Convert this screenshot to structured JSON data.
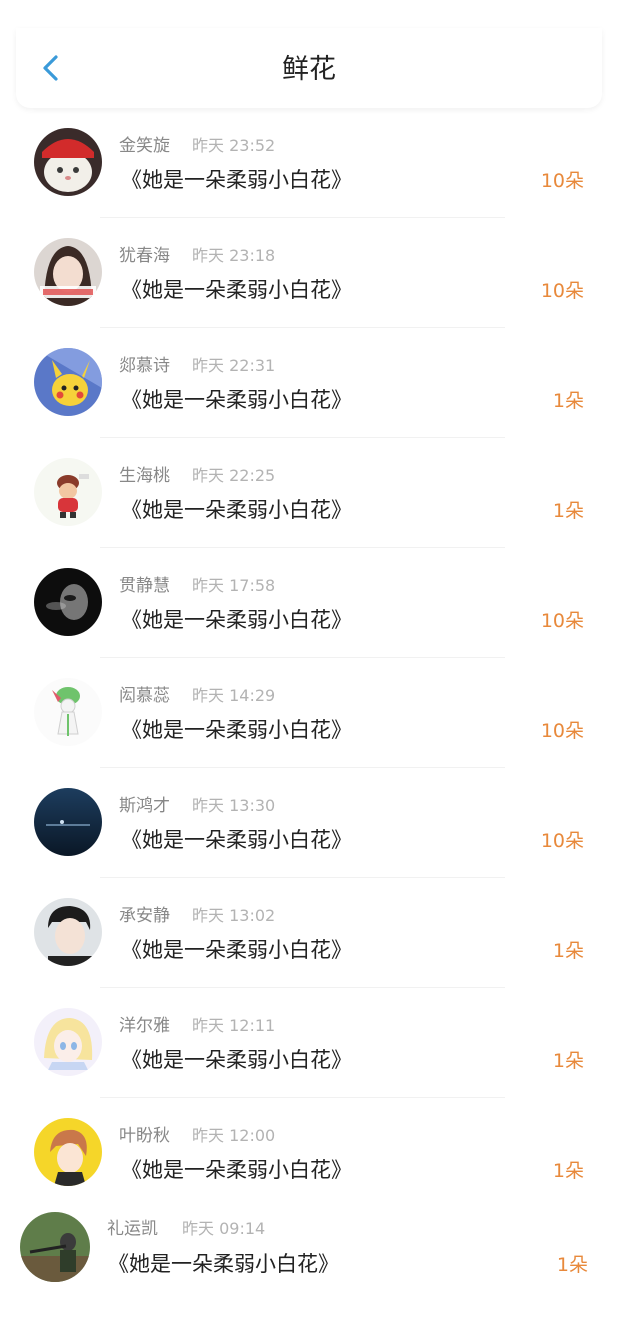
{
  "header": {
    "title": "鲜花",
    "back_icon": "chevron-left-icon",
    "back_color": "#3a9ad9"
  },
  "accent_color": "#e8893b",
  "items": [
    {
      "name": "金笑旋",
      "time": "昨天 23:52",
      "message": "《她是一朵柔弱小白花》",
      "count": "10朵",
      "avatar": "cat-red-cap-avatar"
    },
    {
      "name": "犹春海",
      "time": "昨天 23:18",
      "message": "《她是一朵柔弱小白花》",
      "count": "10朵",
      "avatar": "girl-photo-avatar"
    },
    {
      "name": "郯慕诗",
      "time": "昨天 22:31",
      "message": "《她是一朵柔弱小白花》",
      "count": "1朵",
      "avatar": "pikachu-avatar"
    },
    {
      "name": "生海桃",
      "time": "昨天 22:25",
      "message": "《她是一朵柔弱小白花》",
      "count": "1朵",
      "avatar": "cartoon-boy-avatar"
    },
    {
      "name": "贯静慧",
      "time": "昨天 17:58",
      "message": "《她是一朵柔弱小白花》",
      "count": "10朵",
      "avatar": "dark-portrait-avatar"
    },
    {
      "name": "闳慕蕊",
      "time": "昨天 14:29",
      "message": "《她是一朵柔弱小白花》",
      "count": "10朵",
      "avatar": "green-pokemon-avatar"
    },
    {
      "name": "斯鸿才",
      "time": "昨天 13:30",
      "message": "《她是一朵柔弱小白花》",
      "count": "10朵",
      "avatar": "ocean-night-avatar"
    },
    {
      "name": "承安静",
      "time": "昨天 13:02",
      "message": "《她是一朵柔弱小白花》",
      "count": "1朵",
      "avatar": "young-man-avatar"
    },
    {
      "name": "洋尔雅",
      "time": "昨天 12:11",
      "message": "《她是一朵柔弱小白花》",
      "count": "1朵",
      "avatar": "anime-girl-avatar"
    },
    {
      "name": "叶盼秋",
      "time": "昨天 12:00",
      "message": "《她是一朵柔弱小白花》",
      "count": "1朵",
      "avatar": "anime-boy-yellow-avatar"
    },
    {
      "name": "礼运凯",
      "time": "昨天 09:14",
      "message": "《她是一朵柔弱小白花》",
      "count": "1朵",
      "avatar": "hunter-outdoor-avatar"
    }
  ]
}
